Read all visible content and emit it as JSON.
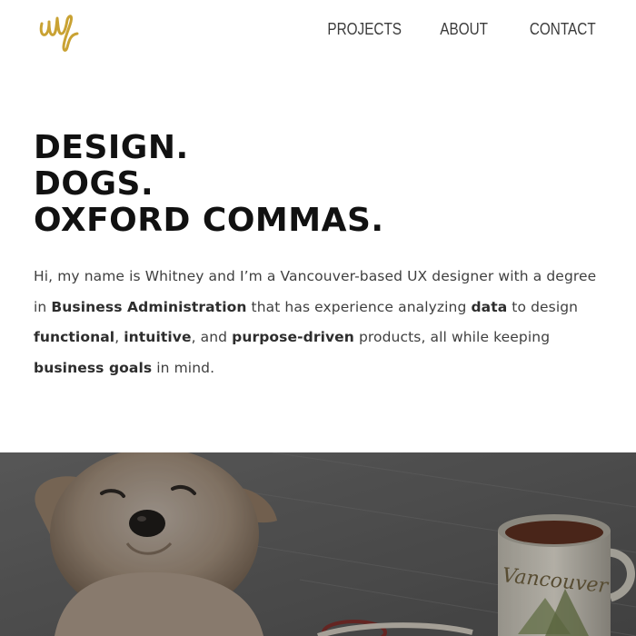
{
  "header": {
    "logo_alt": "wf",
    "nav": [
      {
        "label": "PROJECTS"
      },
      {
        "label": "ABOUT"
      },
      {
        "label": "CONTACT"
      }
    ]
  },
  "hero": {
    "headline": [
      "DESIGN.",
      "DOGS.",
      "OXFORD COMMAS."
    ]
  },
  "intro": [
    {
      "text": "Hi, my name is Whitney and I’m a Vancouver-based UX designer with a degree in ",
      "bold": false
    },
    {
      "text": "Business Administration",
      "bold": true
    },
    {
      "text": " that has experience analyzing ",
      "bold": false
    },
    {
      "text": "data",
      "bold": true
    },
    {
      "text": " to design ",
      "bold": false
    },
    {
      "text": "functional",
      "bold": true
    },
    {
      "text": ", ",
      "bold": false
    },
    {
      "text": "intuitive",
      "bold": true
    },
    {
      "text": ", and ",
      "bold": false
    },
    {
      "text": "purpose-driven",
      "bold": true
    },
    {
      "text": " products, all while keeping ",
      "bold": false
    },
    {
      "text": "business goals",
      "bold": true
    },
    {
      "text": " in mind.",
      "bold": false
    }
  ],
  "photo": {
    "mug_text": "Vancouver"
  },
  "colors": {
    "logo_gold": "#c9a233",
    "headline": "#111111",
    "body_text": "#3f3f3f",
    "nav_text": "#3b3b3b"
  }
}
